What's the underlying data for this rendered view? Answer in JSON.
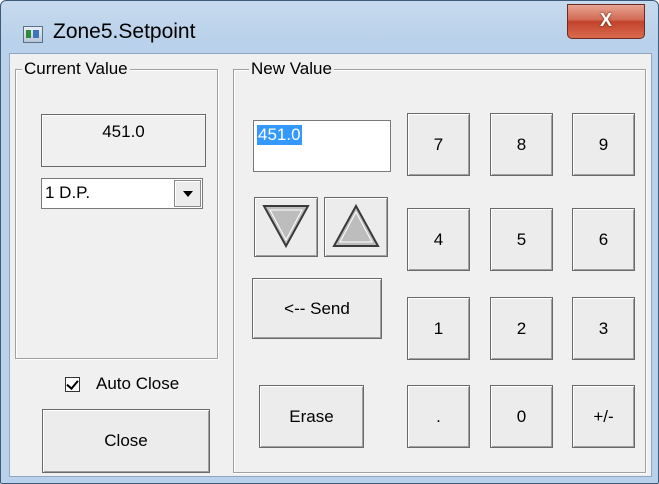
{
  "window": {
    "title": "Zone5.Setpoint",
    "close_glyph": "X"
  },
  "current": {
    "legend": "Current Value",
    "value": "451.0",
    "decimal_select": "1 D.P.",
    "auto_close_label": "Auto Close",
    "auto_close_checked": true,
    "close_label": "Close"
  },
  "new_value": {
    "legend": "New Value",
    "input_value": "451.0",
    "send_label": "<-- Send",
    "erase_label": "Erase",
    "keypad": {
      "k7": "7",
      "k8": "8",
      "k9": "9",
      "k4": "4",
      "k5": "5",
      "k6": "6",
      "k1": "1",
      "k2": "2",
      "k3": "3",
      "kdot": ".",
      "k0": "0",
      "ksign": "+/-"
    },
    "icons": {
      "down": "triangle-down-icon",
      "up": "triangle-up-icon"
    }
  }
}
